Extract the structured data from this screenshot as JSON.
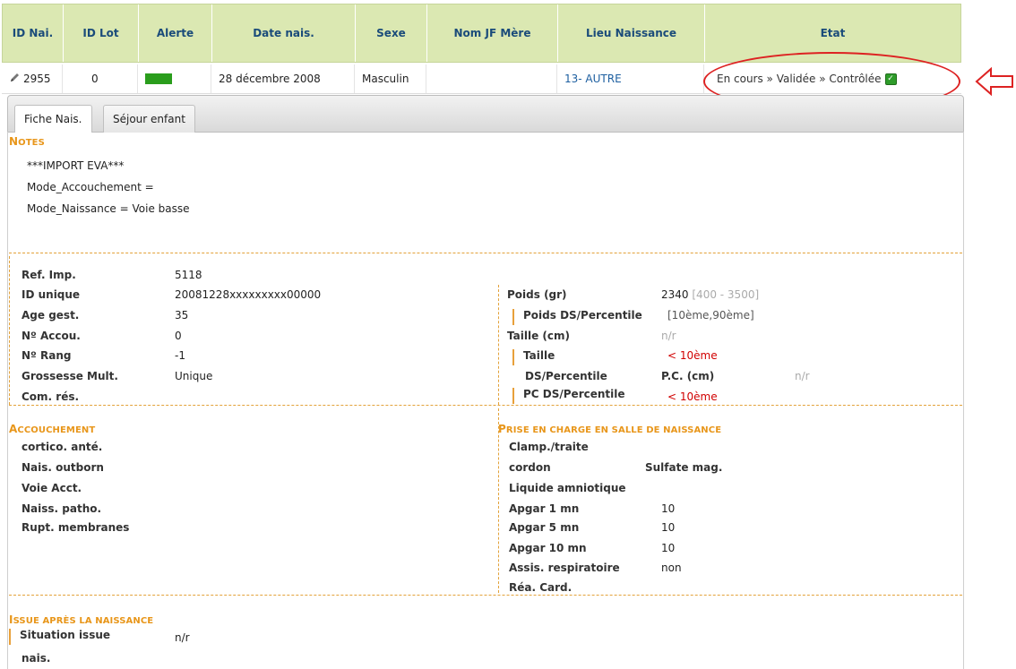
{
  "table": {
    "headers": [
      "ID Nai.",
      "ID Lot",
      "Alerte",
      "Date nais.",
      "Sexe",
      "Nom JF Mère",
      "Lieu Naissance",
      "Etat"
    ],
    "row": {
      "id": "2955",
      "lot": "0",
      "alert_color": "#2a9d1c",
      "date": "28 décembre 2008",
      "sexe": "Masculin",
      "nom_jf": "",
      "lieu": "13- AUTRE",
      "etat": [
        "En cours »",
        "Validée »",
        "Contrôlée"
      ]
    }
  },
  "tabs": [
    "Fiche Nais.",
    "Séjour enfant"
  ],
  "notes": {
    "title_cap": "N",
    "title_rest": "OTES",
    "lines": [
      "***IMPORT EVA***",
      "Mode_Accouchement =",
      "Mode_Naissance = Voie basse"
    ]
  },
  "info_left": [
    {
      "label": "Ref. Imp.",
      "value": "5118"
    },
    {
      "label": "ID unique",
      "value": "20081228xxxxxxxxx00000"
    },
    {
      "label": "Age gest.",
      "value": "35"
    },
    {
      "label": "Nº Accou.",
      "value": "0"
    },
    {
      "label": "Nº Rang",
      "value": "-1"
    },
    {
      "label": "Grossesse Mult.",
      "value": "Unique"
    },
    {
      "label": "Com. rés.",
      "value": ""
    }
  ],
  "info_right": {
    "poids_label": "Poids (gr)",
    "poids_value": "2340",
    "poids_range": "[400 - 3500]",
    "poids_ds_label": "Poids DS/Percentile",
    "poids_ds_value": "[10ème,90ème]",
    "taille_label": "Taille (cm)",
    "taille_value": "n/r",
    "taille_sub_label": "Taille",
    "taille_sub_value": "< 10ème",
    "ds_label": "DS/Percentile",
    "pc_label": "P.C. (cm)",
    "pc_value": "n/r",
    "pc_ds_label": "PC DS/Percentile",
    "pc_ds_value": "< 10ème"
  },
  "accouchement": {
    "title_cap": "A",
    "title_rest": "CCOUCHEMENT",
    "items": [
      "cortico. anté.",
      "Nais. outborn",
      "Voie Acct.",
      "Naiss. patho.",
      "Rupt. membranes"
    ]
  },
  "prise_en_charge": {
    "title_cap": "P",
    "title_rest": "RISE EN CHARGE EN SALLE DE NAISSANCE",
    "clamp_label": "Clamp./traite",
    "cordon_label": "cordon",
    "sulfate_label": "Sulfate mag.",
    "liquide_label": "Liquide amniotique",
    "apgar1_label": "Apgar 1 mn",
    "apgar1_value": "10",
    "apgar5_label": "Apgar 5 mn",
    "apgar5_value": "10",
    "apgar10_label": "Apgar 10 mn",
    "apgar10_value": "10",
    "assis_label": "Assis. respiratoire",
    "assis_value": "non",
    "rea_label": "Réa. Card."
  },
  "issue": {
    "title_cap": "I",
    "title_rest": "SSUE APRÈS LA NAISSANCE",
    "situation_label_1": "Situation issue",
    "situation_label_2": "nais.",
    "situation_value": "n/r"
  }
}
